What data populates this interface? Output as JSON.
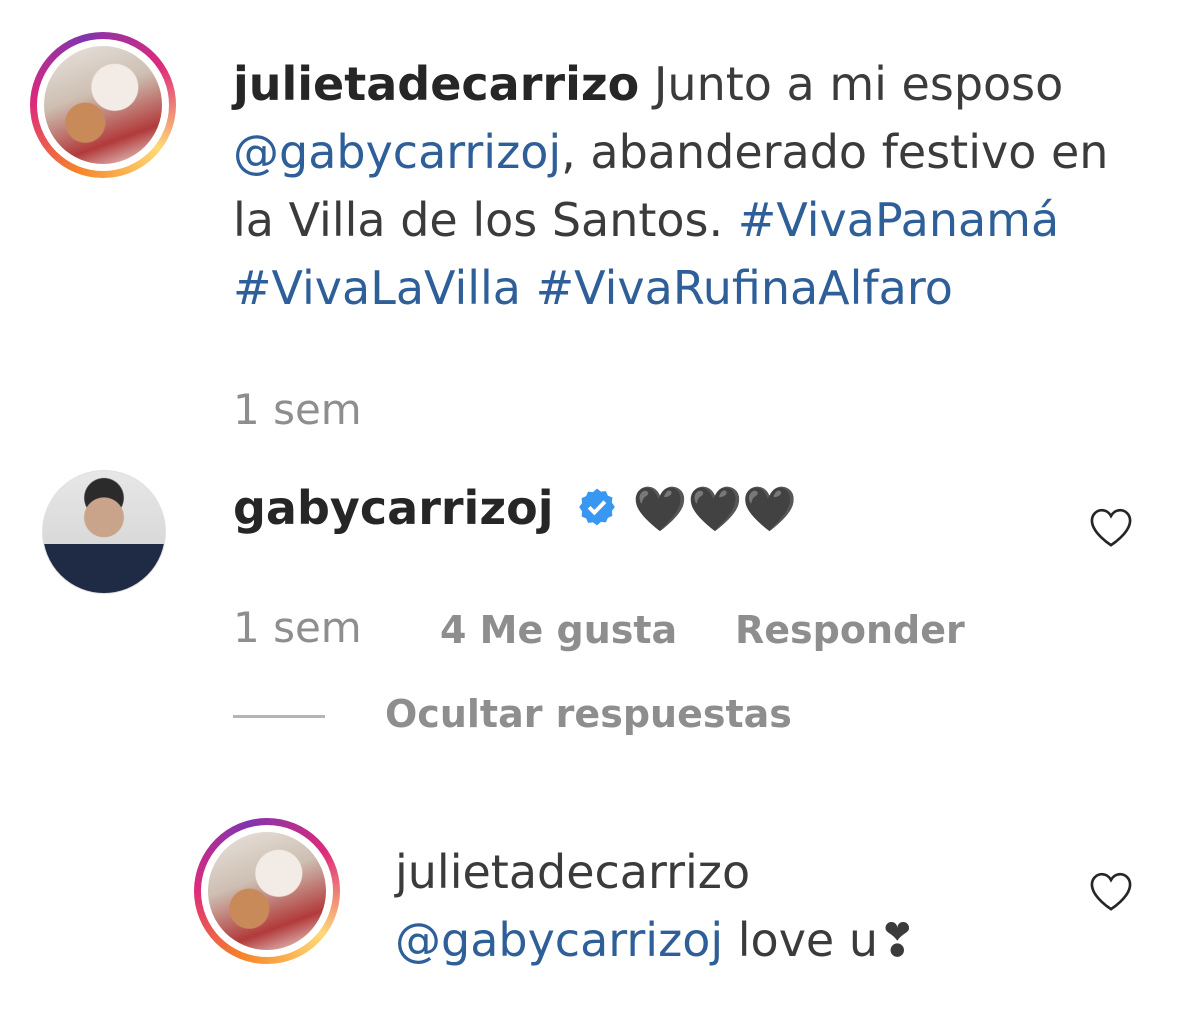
{
  "post": {
    "username": "julietadecarrizo",
    "caption_before": "Junto a mi esposo",
    "mention": "@gabycarrizoj",
    "caption_after": ", abanderado festivo en la Villa de los Santos.",
    "hashtags": [
      "#VivaPanamá",
      "#VivaLaVilla",
      "#VivaRufinaAlfaro"
    ],
    "time": "1 sem"
  },
  "comments": [
    {
      "username": "gabycarrizoj",
      "verified": true,
      "text": "🖤🖤🖤",
      "time": "1 sem",
      "likes": "4 Me gusta",
      "reply_label": "Responder",
      "hide_replies_label": "Ocultar respuestas"
    },
    {
      "username": "julietadecarrizo",
      "mention": "@gabycarrizoj",
      "text": " love u❣"
    }
  ],
  "icons": {
    "heart": "heart-outline-icon",
    "verified": "verified-badge-icon"
  },
  "colors": {
    "link": "#2f5f98",
    "meta": "#8e8e8e",
    "verified": "#3897f0"
  }
}
